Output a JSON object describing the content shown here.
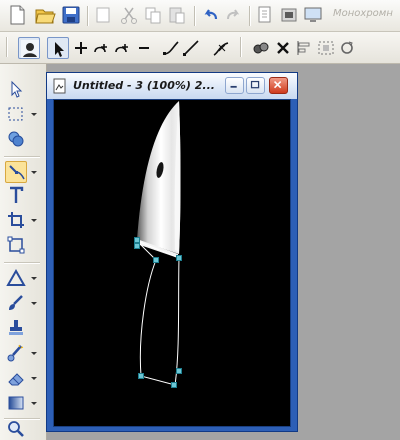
{
  "toolbar": {
    "watermark_label": "Монохромн"
  },
  "document": {
    "title": "Untitled - 3 (100%) 2..."
  },
  "colors": {
    "titlebar_frame": "#2d5fb6",
    "canvas_bg": "#000000",
    "close_button": "#cf3a1c",
    "path_node": "#3fb8c8",
    "selected_tool_bg": "#fbe39a"
  }
}
